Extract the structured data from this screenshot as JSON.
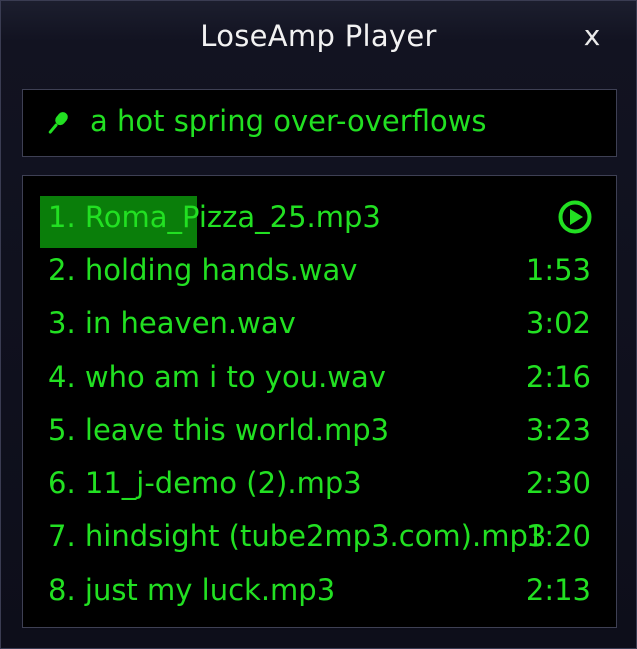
{
  "window": {
    "title": "LoseAmp Player",
    "close_label": "x"
  },
  "now_playing": {
    "icon": "microphone-icon",
    "text": "a hot spring over-overflows"
  },
  "colors": {
    "accent": "#22e022",
    "progress": "#0a7e0a",
    "background": "#000000"
  },
  "playlist": {
    "current_index": 0,
    "current_progress": 0.43,
    "current_icon": "play-circle-icon",
    "tracks": [
      {
        "label": "1. Roma_Pizza_25.mp3",
        "duration": ""
      },
      {
        "label": "2. holding hands.wav",
        "duration": "1:53"
      },
      {
        "label": "3. in heaven.wav",
        "duration": "3:02"
      },
      {
        "label": "4. who am i to you.wav",
        "duration": "2:16"
      },
      {
        "label": "5. leave this world.mp3",
        "duration": "3:23"
      },
      {
        "label": "6. 11_j-demo (2).mp3",
        "duration": "2:30"
      },
      {
        "label": "7. hindsight (tube2mp3.com).mp3",
        "duration": "1:20"
      },
      {
        "label": "8. just my luck.mp3",
        "duration": "2:13"
      }
    ]
  }
}
